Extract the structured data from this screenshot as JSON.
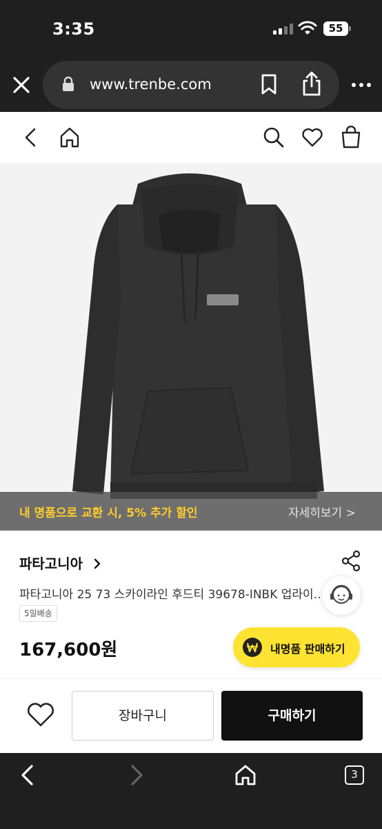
{
  "status_bar": {
    "time": "3:35",
    "battery": "55"
  },
  "browser": {
    "url": "www.trenbe.com",
    "tab_count": "3"
  },
  "promo": {
    "text": "내 명품으로 교환 시, 5% 추가 할인",
    "link": "자세히보기 >"
  },
  "product": {
    "brand": "파타고니아",
    "name": "파타고니아 25 73 스카이라인 후드티 39678-INBK 업라이...",
    "shipping_badge": "5일배송",
    "price": "167,600원"
  },
  "sell_button": {
    "label": "내명품 판매하기"
  },
  "actions": {
    "cart_label": "장바구니",
    "buy_label": "구매하기"
  },
  "colors": {
    "accent_yellow": "#ffe332",
    "promo_text": "#ffcc2a",
    "dark_bar": "#1f1f1f",
    "buy_button": "#111111"
  },
  "icons": [
    "close-icon",
    "lock-icon",
    "bookmark-icon",
    "share-icon",
    "more-icon",
    "back-icon",
    "home-icon",
    "search-icon",
    "heart-icon",
    "shopping-bag-icon",
    "share-node-icon",
    "customer-service-icon",
    "won-icon",
    "chevron-left-icon",
    "chevron-right-icon",
    "tabs-icon"
  ]
}
